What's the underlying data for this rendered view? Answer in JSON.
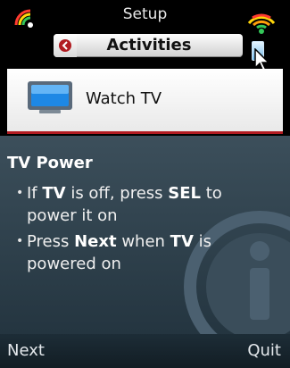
{
  "header": {
    "title": "Setup",
    "tab_label": "Activities"
  },
  "activity": {
    "label": "Watch TV",
    "icon": "tv-icon"
  },
  "info": {
    "title": "TV Power",
    "bullet1": {
      "pre": "If ",
      "b1": "TV",
      "mid": " is off, press ",
      "b2": "SEL",
      "post": " to power it on"
    },
    "bullet2": {
      "pre": "Press ",
      "b1": "Next",
      "mid": " when ",
      "b2": "TV",
      "post": " is powered on"
    }
  },
  "footer": {
    "left": "Next",
    "right": "Quit"
  },
  "colors": {
    "accent": "#b11b21",
    "panel": "#2f404b"
  }
}
